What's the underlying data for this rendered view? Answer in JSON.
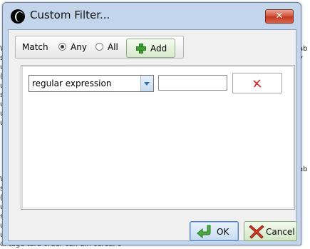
{
  "background": {
    "left_column": [
      "W",
      "s",
      "u",
      "(",
      "u",
      "s",
      "u",
      "u",
      "u"
    ],
    "left_column_lower": [
      "W",
      "s",
      "(",
      "u",
      "s",
      "u",
      "u"
    ],
    "right_column": [
      "ab",
      "y",
      "",
      "",
      "",
      "",
      "",
      "",
      "",
      "",
      "",
      "",
      "",
      "",
      "ab"
    ],
    "bottom_text": "c. tage  tard  order       can  din  cereal  c"
  },
  "window": {
    "title": "Custom Filter...",
    "close_symbol": "✕"
  },
  "toolbar": {
    "match_label": "Match",
    "any_label": "Any",
    "all_label": "All",
    "selected": "Any",
    "add_label": "Add"
  },
  "filter_row": {
    "operator_value": "regular expression",
    "pattern_value": "",
    "remove_icon": "red-x-icon"
  },
  "buttons": {
    "ok_label": "OK",
    "cancel_label": "Cancel"
  },
  "colors": {
    "frame": "#c2d5ea",
    "close": "#d4573f",
    "add_green": "#3fa032",
    "remove_red": "#e02020"
  }
}
